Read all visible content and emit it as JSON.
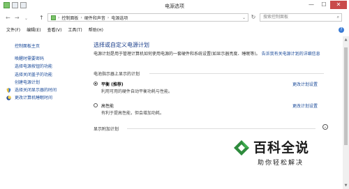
{
  "window": {
    "title": "电源选项",
    "buttons": {
      "minimize": "—",
      "maximize": "☐",
      "close": "✕"
    }
  },
  "navigation": {
    "back": "←",
    "forward": "→",
    "up": "↑",
    "breadcrumb": [
      "控制面板",
      "硬件和声音",
      "电源选项"
    ],
    "search_placeholder": "搜索控制面板",
    "refresh": "↻"
  },
  "menu": [
    "文件(F)",
    "编辑(E)",
    "查看(V)",
    "工具(T)",
    "帮助(H)"
  ],
  "sidebar": {
    "home": "控制面板主页",
    "items": [
      {
        "label": "唤醒时需要密码",
        "icon": ""
      },
      {
        "label": "选择电源按钮的功能",
        "icon": ""
      },
      {
        "label": "选择关闭盖子的功能",
        "icon": ""
      },
      {
        "label": "创建电源计划",
        "icon": ""
      },
      {
        "label": "选择关闭显示器的时间",
        "icon": "shield-icon"
      },
      {
        "label": "更改计算机睡眠时间",
        "icon": "moon-icon"
      }
    ]
  },
  "main": {
    "heading": "选择或自定义电源计划",
    "description": "电源计划是用于管理计算机如何使用电源的一套硬件和系统设置(如显示器亮度、睡眠等)。",
    "description_link": "告诉我有关电源计划的详细信息",
    "battery_section": "电池指示器上显示的计划",
    "plans": [
      {
        "name": "平衡 (推荐)",
        "description": "利用可用的硬件自动平衡功耗与性能。",
        "link": "更改计划设置",
        "selected": true
      },
      {
        "name": "高性能",
        "description": "有利于提高性能，但会增加功耗。",
        "link": "更改计划设置",
        "selected": false
      }
    ],
    "additional_section": "显示附加计划"
  },
  "watermark": {
    "title": "百科全说",
    "subtitle": "助你轻松解决"
  }
}
